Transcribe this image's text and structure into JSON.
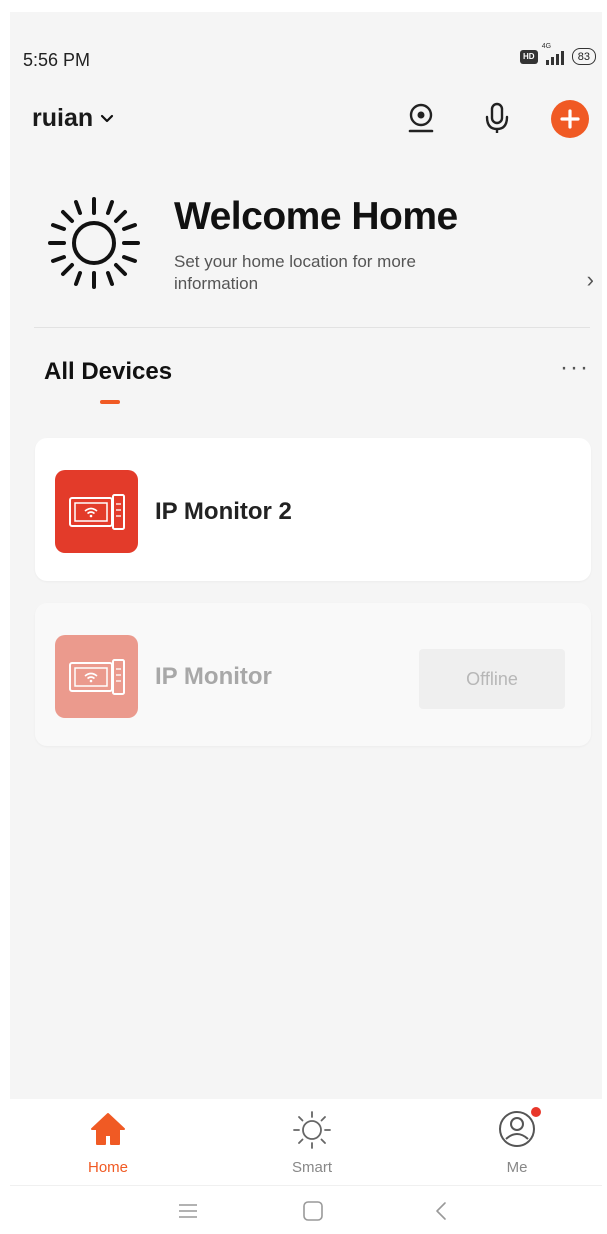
{
  "status_bar": {
    "time": "5:56 PM",
    "hd_badge": "HD",
    "network": "4G",
    "battery": "83"
  },
  "header": {
    "home_name": "ruian",
    "icons": [
      "camera-icon",
      "microphone-icon",
      "add-icon"
    ],
    "accent_color": "#f05a24"
  },
  "welcome": {
    "title": "Welcome Home",
    "subtitle": "Set your home location for more information"
  },
  "devices_section": {
    "title": "All Devices",
    "more": "···"
  },
  "devices": [
    {
      "name": "IP Monitor 2",
      "status": "",
      "icon": "ip-monitor-icon"
    },
    {
      "name": "IP Monitor",
      "status": "Offline",
      "icon": "ip-monitor-icon"
    }
  ],
  "tab_bar": {
    "tabs": [
      {
        "label": "Home",
        "icon": "home-icon",
        "active": true
      },
      {
        "label": "Smart",
        "icon": "sun-icon",
        "active": false
      },
      {
        "label": "Me",
        "icon": "user-icon",
        "active": false
      }
    ]
  },
  "system_nav": [
    "menu-icon",
    "home-square-icon",
    "back-icon"
  ]
}
